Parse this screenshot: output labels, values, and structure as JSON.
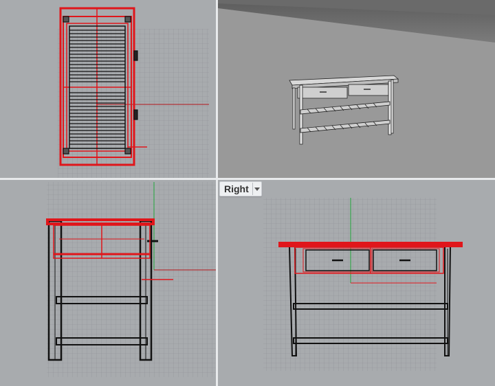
{
  "viewports": {
    "top": {
      "name": ""
    },
    "perspective": {
      "name": ""
    },
    "front": {
      "name": ""
    },
    "right": {
      "name": "Right"
    }
  },
  "colors": {
    "background": "#a8abae",
    "grid": "#8d9195",
    "selection": "#e0161b",
    "wire": "#111111",
    "x_axis": "#b4161b",
    "y_axis": "#1fa53a"
  },
  "icons": [
    "viewport-menu-arrow-icon"
  ]
}
